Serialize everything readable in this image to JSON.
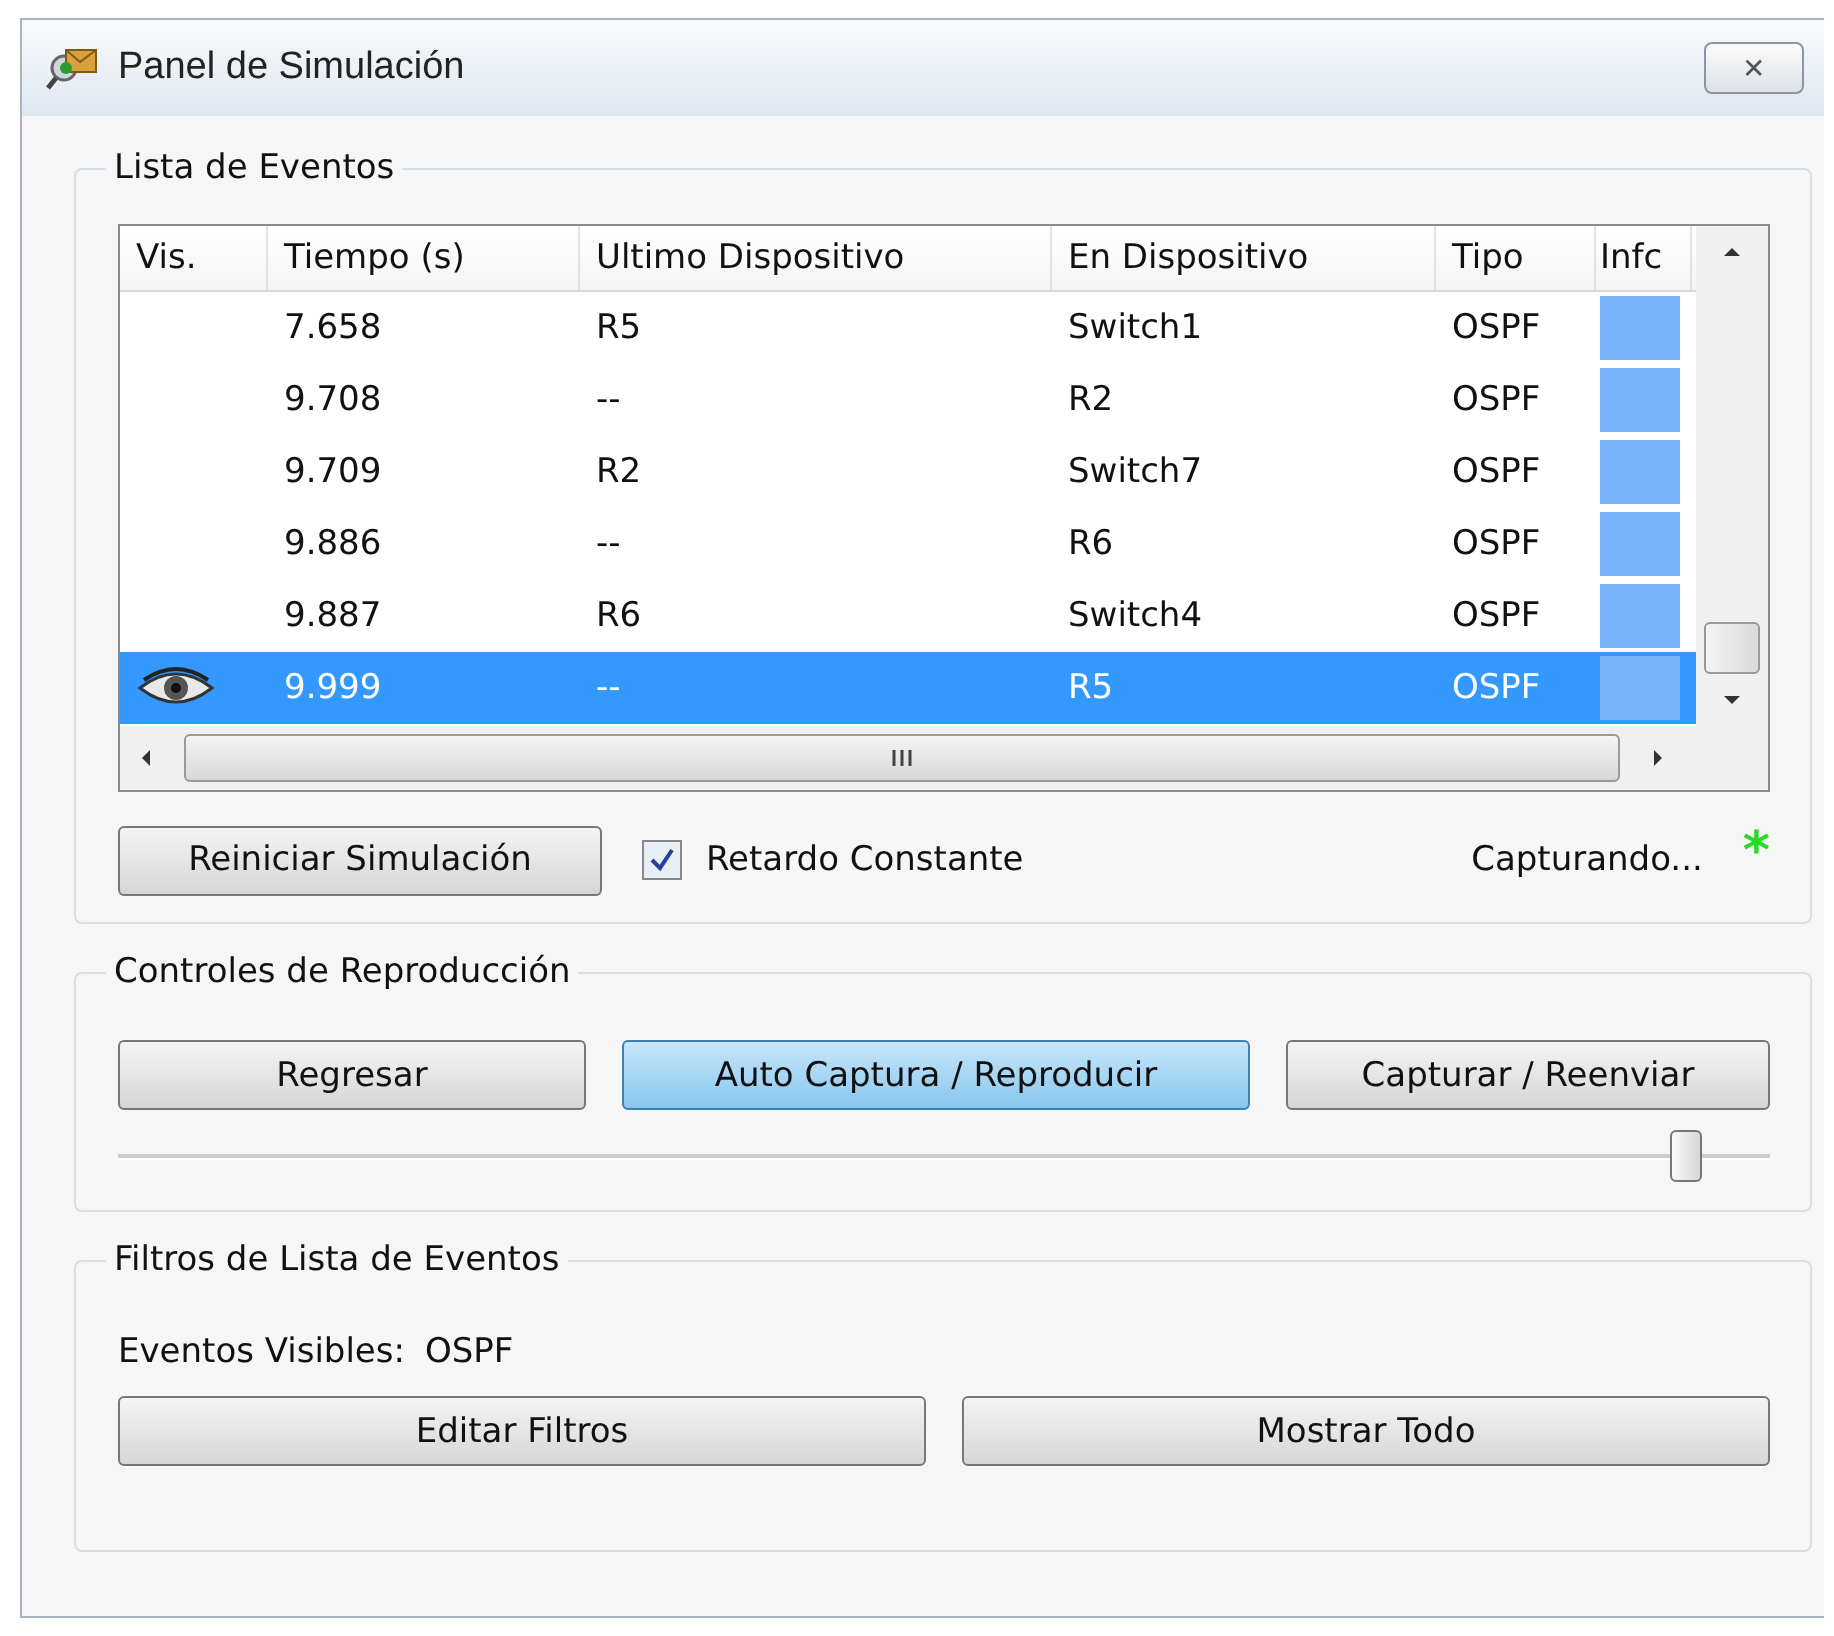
{
  "window": {
    "title": "Panel de Simulación",
    "close": "✕"
  },
  "event_list": {
    "title": "Lista de Eventos",
    "columns": [
      "Vis.",
      "Tiempo (s)",
      "Ultimo Dispositivo",
      "En Dispositivo",
      "Tipo",
      "Infc"
    ],
    "rows": [
      {
        "time": "7.658",
        "last_device": "R5",
        "at_device": "Switch1",
        "type": "OSPF",
        "color": "#78b4fa",
        "selected": false
      },
      {
        "time": "9.708",
        "last_device": "--",
        "at_device": "R2",
        "type": "OSPF",
        "color": "#78b4fa",
        "selected": false
      },
      {
        "time": "9.709",
        "last_device": "R2",
        "at_device": "Switch7",
        "type": "OSPF",
        "color": "#78b4fa",
        "selected": false
      },
      {
        "time": "9.886",
        "last_device": "--",
        "at_device": "R6",
        "type": "OSPF",
        "color": "#78b4fa",
        "selected": false
      },
      {
        "time": "9.887",
        "last_device": "R6",
        "at_device": "Switch4",
        "type": "OSPF",
        "color": "#78b4fa",
        "selected": false
      },
      {
        "time": "9.999",
        "last_device": "--",
        "at_device": "R5",
        "type": "OSPF",
        "color": "#78b4fa",
        "selected": true
      }
    ],
    "reset_button": "Reiniciar Simulación",
    "constant_delay": {
      "label": "Retardo Constante",
      "checked": true
    },
    "status": "Capturando...",
    "status_mark": "*"
  },
  "playback": {
    "title": "Controles de Reproducción",
    "buttons": [
      {
        "label": "Regresar",
        "selected": false
      },
      {
        "label": "Auto Captura / Reproducir",
        "selected": true
      },
      {
        "label": "Capturar / Reenviar",
        "selected": false
      }
    ],
    "speed": {
      "level": 0.95
    }
  },
  "filters": {
    "title": "Filtros de Lista de Eventos",
    "visible_label": "Eventos Visibles:",
    "visible_value": "OSPF",
    "buttons": [
      "Editar Filtros",
      "Mostrar Todo"
    ]
  }
}
